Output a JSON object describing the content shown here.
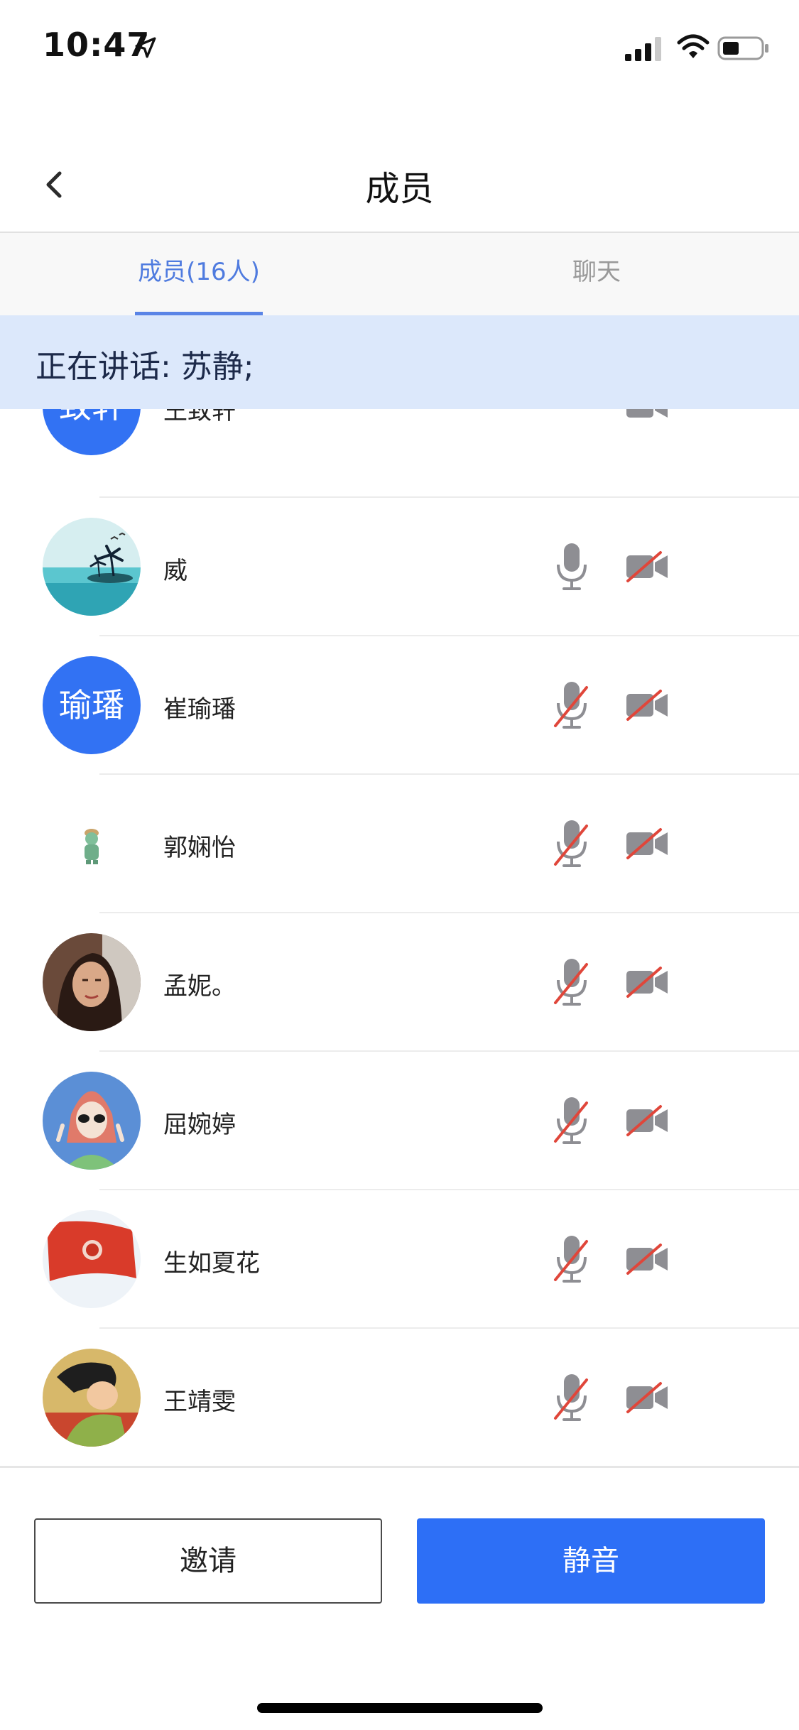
{
  "status_bar": {
    "time": "10:47"
  },
  "header": {
    "title": "成员"
  },
  "tabs": [
    {
      "label": "成员(16人)",
      "active": true
    },
    {
      "label": "聊天",
      "active": false
    }
  ],
  "speaking": {
    "text": "正在讲话: 苏静;"
  },
  "members": [
    {
      "name": "王致轩",
      "avatar_text": "致轩",
      "avatar_type": "text",
      "mic": "hidden",
      "camera": "on"
    },
    {
      "name": "威",
      "avatar_type": "image-beach",
      "mic": "on",
      "camera": "off"
    },
    {
      "name": "崔瑜璠",
      "avatar_text": "瑜璠",
      "avatar_type": "text",
      "mic": "off",
      "camera": "off"
    },
    {
      "name": "郭娴怡",
      "avatar_type": "image-figurine",
      "mic": "off",
      "camera": "off"
    },
    {
      "name": "孟妮。",
      "avatar_type": "image-portrait",
      "mic": "off",
      "camera": "off"
    },
    {
      "name": "屈婉婷",
      "avatar_type": "image-cartoon",
      "mic": "off",
      "camera": "off"
    },
    {
      "name": "生如夏花",
      "avatar_type": "image-flag",
      "mic": "off",
      "camera": "off"
    },
    {
      "name": "王靖雯",
      "avatar_type": "image-mulan",
      "mic": "off",
      "camera": "off"
    }
  ],
  "footer": {
    "invite_label": "邀请",
    "mute_label": "静音"
  },
  "colors": {
    "accent": "#2d6ff6",
    "tab_active": "#4f7bdf",
    "banner_bg": "#dce8fb",
    "icon_gray": "#8e8e93",
    "off_slash": "#e0463a"
  }
}
